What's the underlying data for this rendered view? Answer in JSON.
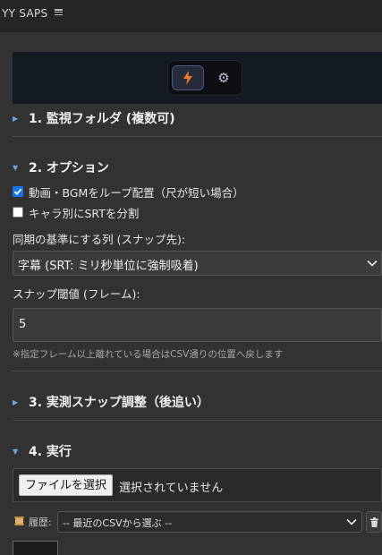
{
  "app": {
    "title": "YY SAPS"
  },
  "mode_switch": {
    "active": "lightning-icon",
    "second": "gear-icon"
  },
  "sections": [
    {
      "number_label": "1. 監視フォルダ (複数可)",
      "expanded": false
    },
    {
      "number_label": "2. オプション",
      "expanded": true
    },
    {
      "number_label": "3. 実測スナップ調整（後追い）",
      "expanded": false
    },
    {
      "number_label": "4. 実行",
      "expanded": true
    }
  ],
  "options": {
    "loop_checkbox": {
      "label": "動画・BGMをループ配置（尺が短い場合）",
      "checked": true
    },
    "split_checkbox": {
      "label": "キャラ別にSRTを分割",
      "checked": false
    },
    "sync_label": "同期の基準にする列 (スナップ先):",
    "sync_value": "字幕 (SRT: ミリ秒単位に強制吸着)",
    "snap_label": "スナップ閾値 (フレーム):",
    "snap_value": "5",
    "hint": "※指定フレーム以上離れている場合はCSV通りの位置へ戻します"
  },
  "execute": {
    "file_button": "ファイルを選択",
    "file_status": "選択されていません",
    "history_label": "履歴:",
    "history_value": "-- 最近のCSVから選ぶ --"
  },
  "colors": {
    "accent": "#6fa4dc",
    "lightning": "#f2772a",
    "checkbox": "#1a73e8"
  }
}
